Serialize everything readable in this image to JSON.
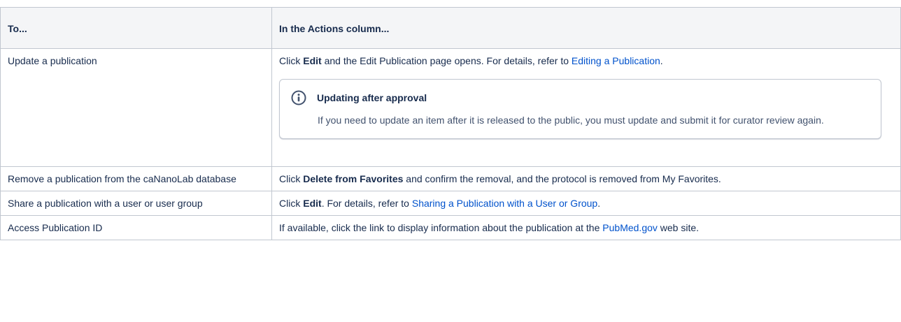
{
  "table": {
    "headers": [
      "To...",
      "In the Actions column..."
    ],
    "rows": [
      {
        "to": "Update a publication",
        "action_pre": "Click ",
        "action_bold": "Edit",
        "action_mid": " and the Edit Publication page opens. For details, refer to ",
        "action_link": "Editing a Publication",
        "action_post": ".",
        "panel": {
          "title": "Updating after approval",
          "body": "If you need to update an item after it is released to the public, you must update and submit it for curator review again."
        }
      },
      {
        "to": "Remove a publication from the caNanoLab database",
        "action_pre": "Click ",
        "action_bold": "Delete from Favorites",
        "action_post": " and confirm the removal, and the protocol is removed from My Favorites."
      },
      {
        "to": "Share a publication with a user or user group",
        "action_pre": "Click ",
        "action_bold": "Edit",
        "action_mid": ". For details, refer to ",
        "action_link": "Sharing a Publication with a User or Group",
        "action_post": "."
      },
      {
        "to": "Access Publication ID",
        "action_pre": "If available, click the link to display information about the publication at the ",
        "action_link": "PubMed.gov",
        "action_post": " web site."
      }
    ]
  },
  "colors": {
    "link": "#0052cc",
    "border": "#c1c7d0",
    "header_bg": "#f4f5f7",
    "info_icon": "#42526e"
  },
  "icons": {
    "info": "info-circle-icon"
  }
}
